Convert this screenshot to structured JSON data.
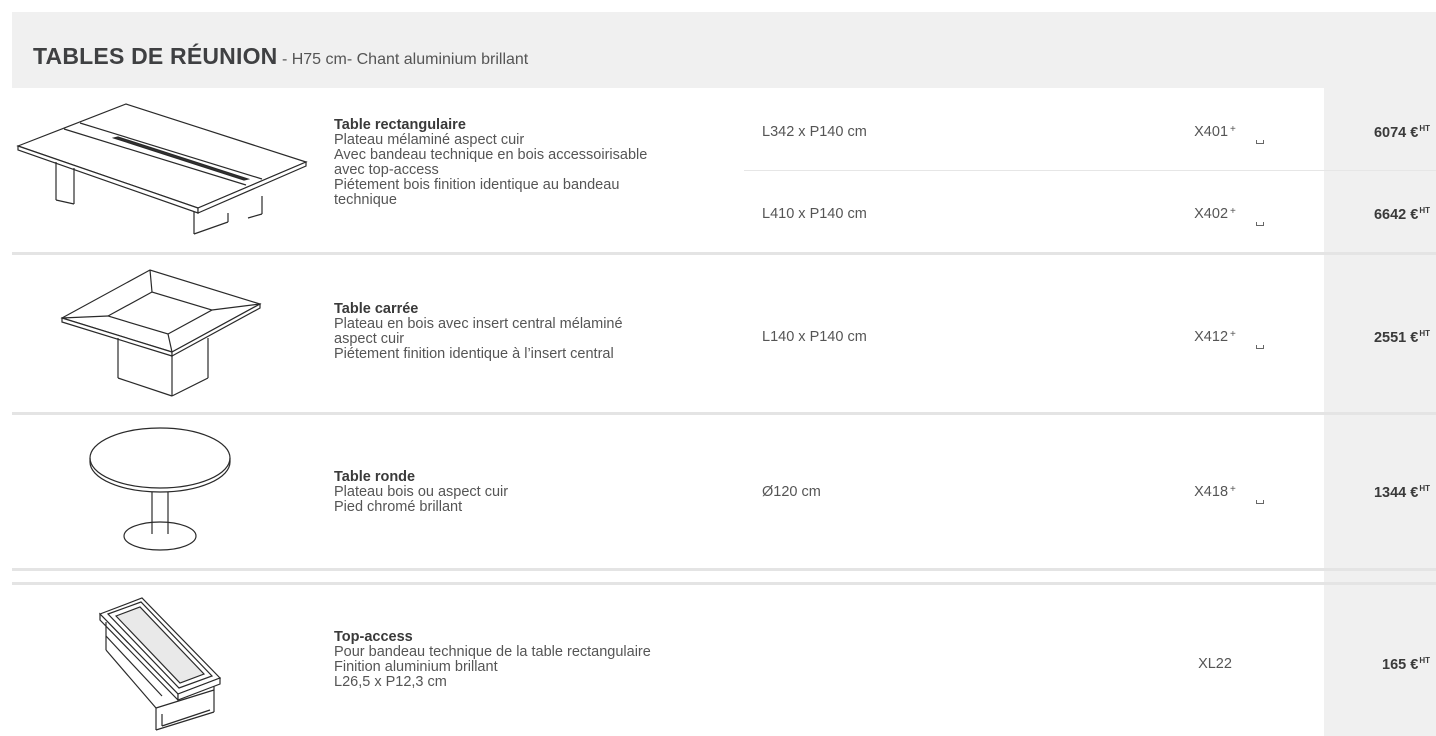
{
  "header": {
    "title": "TABLES DE RÉUNION",
    "separator": " - ",
    "subtitle": "H75 cm- Chant aluminium brillant"
  },
  "products": [
    {
      "image_icon": "rectangular-table-icon",
      "name": "Table rectangulaire",
      "lines": [
        "Plateau mélaminé aspect cuir",
        "Avec bandeau technique en bois accessoirisable",
        "avec top-access",
        "Piétement bois finition identique au bandeau",
        "technique"
      ],
      "variants": [
        {
          "dimensions": "L342 x P140 cm",
          "ref": "X401",
          "price": "6074 €",
          "suffix": "HT"
        },
        {
          "dimensions": "L410 x P140 cm",
          "ref": "X402",
          "price": "6642 €",
          "suffix": "HT"
        }
      ]
    },
    {
      "image_icon": "square-table-icon",
      "name": "Table carrée",
      "lines": [
        "Plateau en bois avec insert central mélaminé",
        "aspect cuir",
        "Piétement finition identique à l’insert central"
      ],
      "variants": [
        {
          "dimensions": "L140 x P140 cm",
          "ref": "X412",
          "price": "2551 €",
          "suffix": "HT"
        }
      ]
    },
    {
      "image_icon": "round-table-icon",
      "name": "Table ronde",
      "lines": [
        "Plateau bois ou aspect cuir",
        "Pied chromé brillant"
      ],
      "variants": [
        {
          "dimensions": "Ø120 cm",
          "ref": "X418",
          "price": "1344 €",
          "suffix": "HT"
        }
      ]
    },
    {
      "image_icon": "top-access-icon",
      "name": "Top-access",
      "lines": [
        "Pour bandeau technique de la table rectangulaire",
        "Finition aluminium brillant",
        "L26,5 x P12,3 cm"
      ],
      "variants": [
        {
          "dimensions": "",
          "ref": "XL22",
          "price": "165 €",
          "suffix": "HT"
        }
      ]
    }
  ],
  "symbols": {
    "plus": "+"
  },
  "colors": {
    "band": "#f0f0f0",
    "text": "#555555",
    "heading": "#3f4042"
  }
}
